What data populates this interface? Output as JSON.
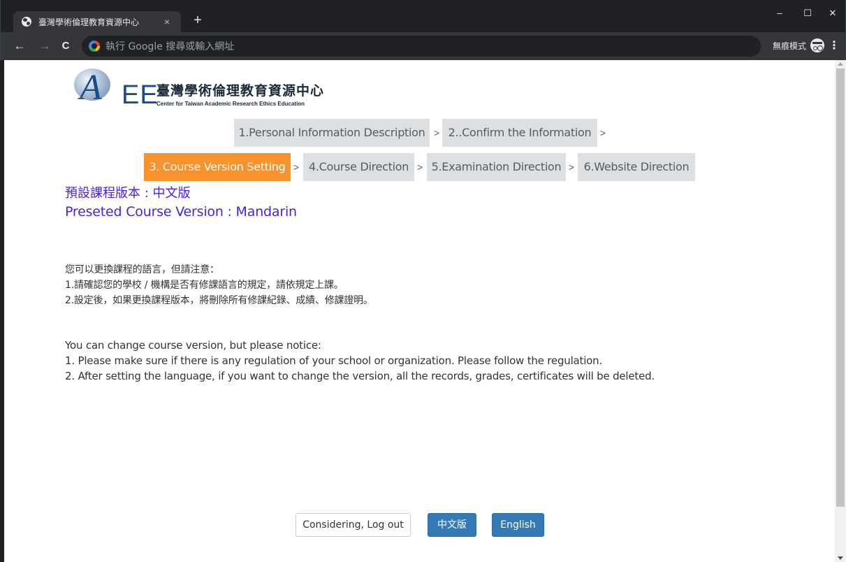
{
  "browser": {
    "tab_title": "臺灣學術倫理教育資源中心",
    "tab_close": "×",
    "new_tab": "+",
    "window_controls": {
      "minimize": "–",
      "maximize": "☐",
      "close": "✕"
    },
    "nav": {
      "back": "←",
      "forward": "→",
      "reload": "C"
    },
    "omnibox_placeholder": "執行 Google 搜尋或輸入網址",
    "incognito_label": "無痕模式",
    "menu": "⋮"
  },
  "logo": {
    "mark": "A",
    "mark_ee": "EE",
    "name_zh": "臺灣學術倫理教育資源中心",
    "name_en": "Center for Taiwan Academic Research Ethics Education"
  },
  "steps": {
    "separator": ">",
    "items": [
      {
        "label": "1.Personal Information Description",
        "active": false
      },
      {
        "label": "2..Confirm the Information",
        "active": false
      },
      {
        "label": "3. Course Version Setting",
        "active": true
      },
      {
        "label": "4.Course Direction",
        "active": false
      },
      {
        "label": "5.Examination Direction",
        "active": false
      },
      {
        "label": "6.Website Direction",
        "active": false
      }
    ]
  },
  "preset": {
    "zh": "預設課程版本 : 中文版",
    "en": "Preseted Course Version : Mandarin"
  },
  "notice_zh": [
    "您可以更換課程的語言，但請注意：",
    "1.請確認您的學校 / 機構是否有修課語言的規定，請依規定上課。",
    "2.設定後，如果更換課程版本，將刪除所有修課紀錄、成績、修課證明。"
  ],
  "notice_en": [
    "You can change course version, but please notice:",
    "1. Please make sure if there is any regulation of your school or organization. Please follow the regulation.",
    "2. After setting the language, if you want to change the version, all the records, grades, certificates will be deleted."
  ],
  "buttons": {
    "logout": "Considering, Log out",
    "chinese": "中文版",
    "english": "English"
  },
  "colors": {
    "active_step": "#f7922d",
    "inactive_step": "#dde0e3",
    "preset_text": "#4b1fe6",
    "primary_button": "#337ab7"
  }
}
